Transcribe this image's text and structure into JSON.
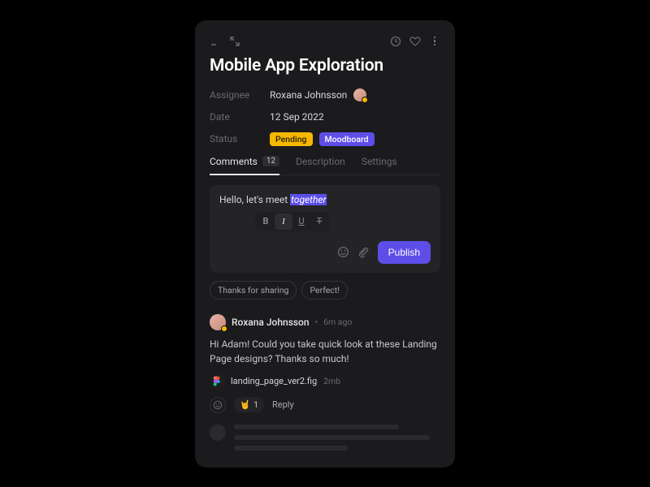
{
  "title": "Mobile App Exploration",
  "meta": {
    "assignee_label": "Assignee",
    "assignee_name": "Roxana Johnsson",
    "date_label": "Date",
    "date_value": "12 Sep 2022",
    "status_label": "Status",
    "status_badges": {
      "pending": "Pending",
      "moodboard": "Moodboard"
    }
  },
  "tabs": {
    "comments": "Comments",
    "comments_count": "12",
    "description": "Description",
    "settings": "Settings"
  },
  "composer": {
    "text_prefix": "Hello, let's meet ",
    "text_highlight": "together",
    "toolbar": {
      "bold": "B",
      "italic": "I",
      "underline": "U",
      "strike": "T"
    },
    "publish": "Publish"
  },
  "quick_replies": {
    "r1": "Thanks for sharing",
    "r2": "Perfect!"
  },
  "comment": {
    "author": "Roxana Johnsson",
    "sep": "•",
    "time": "6m ago",
    "body": "Hi Adam! Could you take quick look at these Landing Page designs? Thanks so much!",
    "file_name": "landing_page_ver2.fig",
    "file_size": "2mb",
    "reaction_emoji": "🤘",
    "reaction_count": "1",
    "reply": "Reply"
  },
  "colors": {
    "accent": "#5d4ee8",
    "warning": "#f5b800"
  }
}
